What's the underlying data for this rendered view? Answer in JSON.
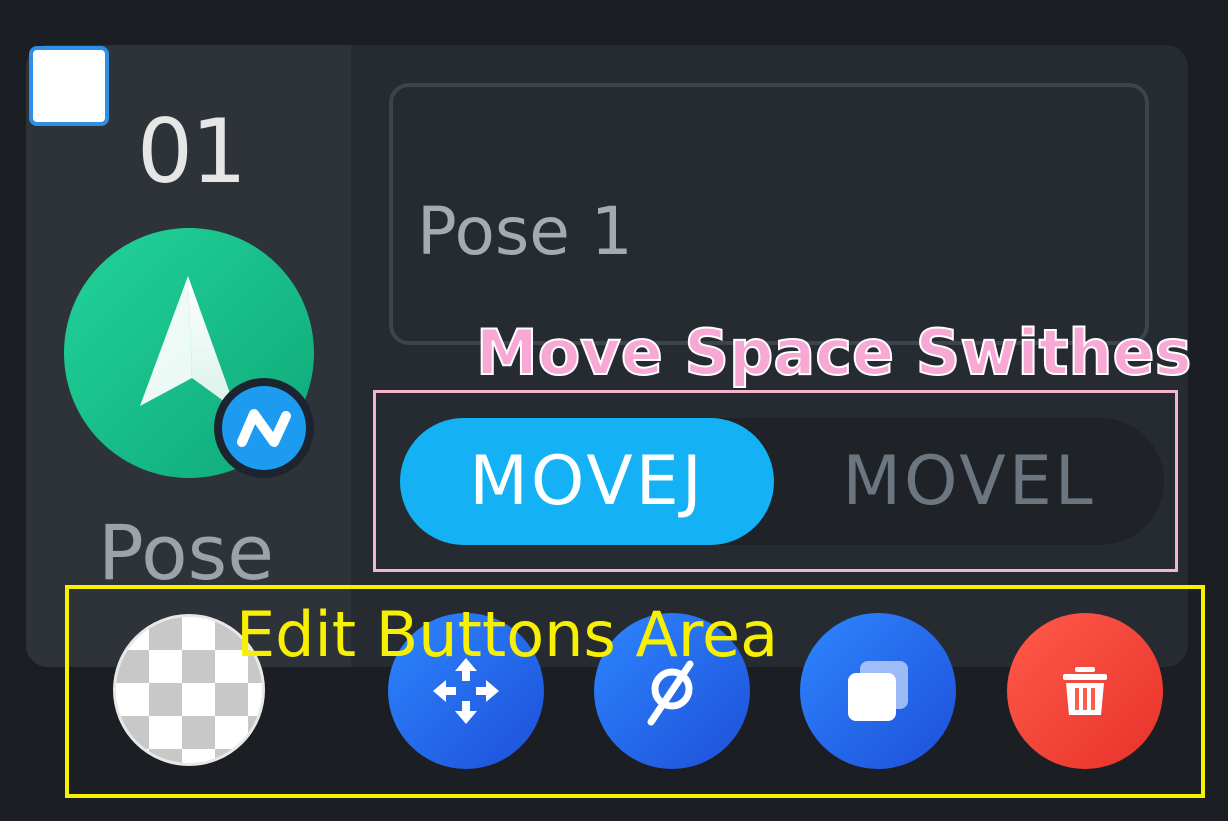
{
  "pose_card": {
    "index": "01",
    "type_label": "Pose",
    "name_value": "Pose 1",
    "checkbox_checked": false
  },
  "move_space": {
    "options": [
      {
        "label": "MOVEJ",
        "active": true
      },
      {
        "label": "MOVEL",
        "active": false
      }
    ]
  },
  "annotations": {
    "move_space_label": "Move Space Swithes",
    "edit_buttons_label": "Edit Buttons Area"
  },
  "edit_buttons": {
    "icons": [
      "thumbnail",
      "move-arrows-icon",
      "relax-icon",
      "duplicate-icon",
      "trash-icon"
    ]
  },
  "colors": {
    "background": "#1b1e23",
    "card": "#262b31",
    "active_toggle": "#14b1f5",
    "pose_icon": "#16c08a",
    "edit_blue": "#2e86ff",
    "delete_red": "#ff5a4a",
    "annotation_pink": "#f2b6cb",
    "annotation_yellow": "#f7f000"
  }
}
